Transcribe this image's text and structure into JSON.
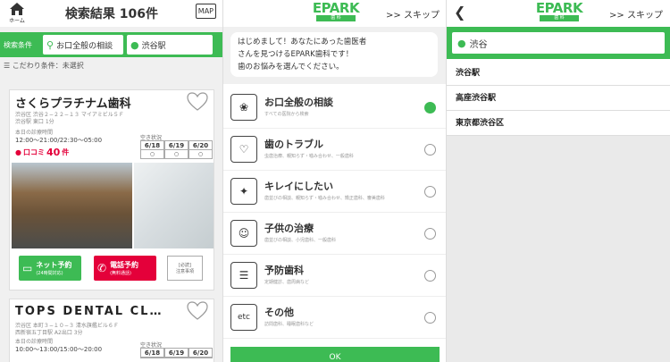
{
  "screen1": {
    "home_label": "ホーム",
    "title": "検索結果 106件",
    "map_label": "MAP",
    "search_label": "検索条件",
    "keyword_value": "お口全般の相談",
    "location_value": "渋谷駅",
    "filter_label": "こだわり条件：",
    "filter_value": "未選択",
    "cards": [
      {
        "name": "さくらプラチナム歯科",
        "address": "渋谷区 渋谷２−２２−１３ マイアミビル５Ｆ",
        "station": "渋谷駅 東口 1分",
        "hours_label": "本日の診療時間",
        "hours": "12:00〜21:00/22:30〜05:00",
        "review_label": "口コミ",
        "review_count": "40",
        "review_unit": "件",
        "avail_label": "空き状況",
        "dates": [
          "6/18",
          "6/19",
          "6/20"
        ],
        "marks": [
          "○",
          "○",
          "○"
        ],
        "net_label": "ネット予約",
        "net_sub": "(24時間対応)",
        "tel_label": "電話予約",
        "tel_sub": "(無料通話)",
        "note_label_1": "[必読]",
        "note_label_2": "注意事項"
      },
      {
        "name": "TOPS DENTAL CL…",
        "address": "渋谷区 本町３−１０−３ 清水旗艦ビル６Ｆ",
        "station": "西新宿五丁目駅 A2出口 3分",
        "hours_label": "本日の診療時間",
        "hours": "10:00〜13:00/15:00〜20:00",
        "avail_label": "空き状況",
        "dates": [
          "6/18",
          "6/19",
          "6/20"
        ]
      }
    ]
  },
  "screen2": {
    "logo": "EPARK",
    "logo_sub": "歯 科",
    "skip_label": "スキップ",
    "intro": [
      "はじめまして！あなたにあった歯医者",
      "さんを見つけるEPARK歯科です！",
      "歯のお悩みを選んでください。"
    ],
    "options": [
      {
        "title": "お口全般の相談",
        "sub": "すべての医院から検索",
        "selected": true
      },
      {
        "title": "歯のトラブル",
        "sub": "虫歯治療、親知らず・噛み合わせ、一般歯科",
        "selected": false
      },
      {
        "title": "キレイにしたい",
        "sub": "歯並びの相談、親知らず・噛み合わせ、矯正歯科、審美歯科",
        "selected": false
      },
      {
        "title": "子供の治療",
        "sub": "歯並びの相談、小児歯科、一般歯科",
        "selected": false
      },
      {
        "title": "予防歯科",
        "sub": "定期健診、歯周病など",
        "selected": false
      },
      {
        "title": "その他",
        "sub": "訪問歯科、睡眠歯科など",
        "selected": false
      }
    ],
    "etc_icon_label": "etc",
    "ok_label": "OK"
  },
  "screen3": {
    "logo": "EPARK",
    "logo_sub": "歯 科",
    "skip_label": "スキップ",
    "search_value": "渋谷",
    "suggestions": [
      "渋谷駅",
      "高座渋谷駅",
      "東京都渋谷区"
    ]
  },
  "colors": {
    "brand_green": "#3dbb54",
    "accent_red": "#e4003a"
  }
}
